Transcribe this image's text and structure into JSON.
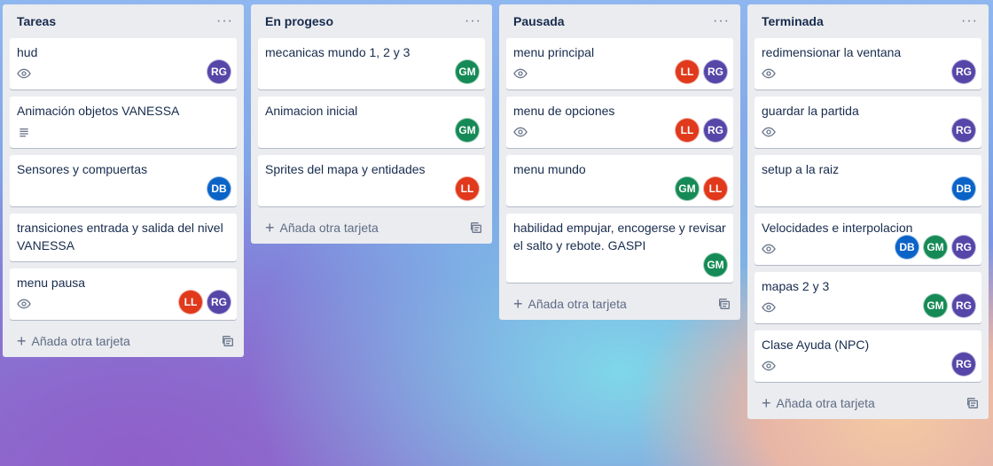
{
  "board": {
    "add_card_label": "Añada otra tarjeta",
    "more_icon": "more-horizontal-icon",
    "lists": [
      {
        "title": "Tareas",
        "cards": [
          {
            "title": "hud",
            "badge": "eye",
            "members": [
              "RG"
            ]
          },
          {
            "title": "Animación objetos VANESSA",
            "badge": "description",
            "members": []
          },
          {
            "title": "Sensores y compuertas",
            "badge": "",
            "members": [
              "DB"
            ]
          },
          {
            "title": "transiciones entrada y salida del nivel VANESSA",
            "badge": "",
            "members": []
          },
          {
            "title": "menu pausa",
            "badge": "eye",
            "members": [
              "LL",
              "RG"
            ]
          }
        ]
      },
      {
        "title": "En progeso",
        "cards": [
          {
            "title": "mecanicas mundo 1, 2 y 3",
            "badge": "",
            "members": [
              "GM"
            ]
          },
          {
            "title": "Animacion inicial",
            "badge": "",
            "members": [
              "GM"
            ]
          },
          {
            "title": "Sprites del mapa y entidades",
            "badge": "",
            "members": [
              "LL"
            ]
          }
        ]
      },
      {
        "title": "Pausada",
        "cards": [
          {
            "title": "menu principal",
            "badge": "eye",
            "members": [
              "LL",
              "RG"
            ]
          },
          {
            "title": "menu de opciones",
            "badge": "eye",
            "members": [
              "LL",
              "RG"
            ]
          },
          {
            "title": "menu mundo",
            "badge": "",
            "members": [
              "GM",
              "LL"
            ]
          },
          {
            "title": "habilidad empujar, encogerse y revisar el salto y rebote. GASPI",
            "badge": "",
            "members": [
              "GM"
            ]
          }
        ]
      },
      {
        "title": "Terminada",
        "cards": [
          {
            "title": "redimensionar la ventana",
            "badge": "eye",
            "members": [
              "RG"
            ]
          },
          {
            "title": "guardar la partida",
            "badge": "eye",
            "members": [
              "RG"
            ]
          },
          {
            "title": "setup a la raiz",
            "badge": "",
            "members": [
              "DB"
            ]
          },
          {
            "title": "Velocidades e interpolacion",
            "badge": "eye",
            "members": [
              "DB",
              "GM",
              "RG"
            ]
          },
          {
            "title": "mapas 2 y 3",
            "badge": "eye",
            "members": [
              "GM",
              "RG"
            ]
          },
          {
            "title": "Clase Ayuda (NPC)",
            "badge": "eye",
            "members": [
              "RG"
            ]
          }
        ]
      }
    ]
  },
  "colors": {
    "RG": "#5546a8",
    "GM": "#168a56",
    "LL": "#e0391b",
    "DB": "#0b63c7",
    "list_bg": "#ebecf0"
  }
}
